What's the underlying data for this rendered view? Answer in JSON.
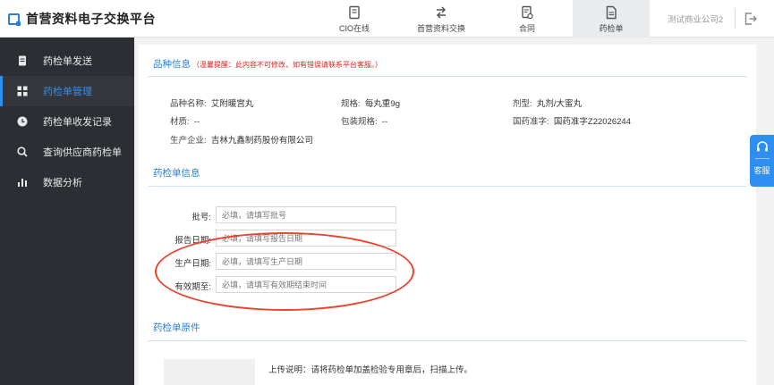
{
  "header": {
    "logo_text": "首营资料电子交换平台",
    "nav": [
      {
        "label": "CIO在线",
        "icon": "book-icon"
      },
      {
        "label": "首营资料交换",
        "icon": "exchange-icon"
      },
      {
        "label": "合同",
        "icon": "contract-icon"
      },
      {
        "label": "药检单",
        "icon": "report-icon",
        "active": true
      }
    ],
    "company": "测试商业公司2",
    "logout_icon": "logout-icon"
  },
  "sidebar": {
    "items": [
      {
        "label": "药检单发送",
        "icon": "document-icon"
      },
      {
        "label": "药检单管理",
        "icon": "grid-icon",
        "active": true
      },
      {
        "label": "药检单收发记录",
        "icon": "clock-icon"
      },
      {
        "label": "查询供应商药检单",
        "icon": "search-icon"
      },
      {
        "label": "数据分析",
        "icon": "bar-chart-icon"
      }
    ],
    "active_color": "#2f8ff0"
  },
  "variety": {
    "title": "品种信息",
    "note": "（温馨提醒：此内容不可修改，如有错误请联系平台客服。）",
    "fields": {
      "name": {
        "label": "品种名称:",
        "value": "艾附暖宫丸"
      },
      "spec": {
        "label": "规格:",
        "value": "每丸重9g"
      },
      "dosage": {
        "label": "剂型:",
        "value": "丸剂/大蜜丸"
      },
      "material": {
        "label": "材质:",
        "value": "--"
      },
      "package": {
        "label": "包装规格:",
        "value": "--"
      },
      "approval": {
        "label": "国药准字:",
        "value": "国药准字Z22026244"
      },
      "manufacturer": {
        "label": "生产企业:",
        "value": "吉林九鑫制药股份有限公司"
      }
    }
  },
  "report": {
    "title": "药检单信息",
    "fields": [
      {
        "label": "批号:",
        "placeholder": "必填，请填写批号"
      },
      {
        "label": "报告日期:",
        "placeholder": "必填，请填写报告日期"
      },
      {
        "label": "生产日期:",
        "placeholder": "必填，请填写生产日期"
      },
      {
        "label": "有效期至:",
        "placeholder": "必填，请填写有效期结束时间"
      }
    ],
    "highlight_color": "#e8452e"
  },
  "original": {
    "title": "药检单原件",
    "upload_note": "上传说明：请将药检单加盖检验专用章后，扫描上传。"
  },
  "service": {
    "label": "客服",
    "icon": "headset-icon"
  },
  "colors": {
    "accent": "#2a7fd0",
    "note": "#e02020",
    "sidebar_bg": "#2b2e33"
  }
}
